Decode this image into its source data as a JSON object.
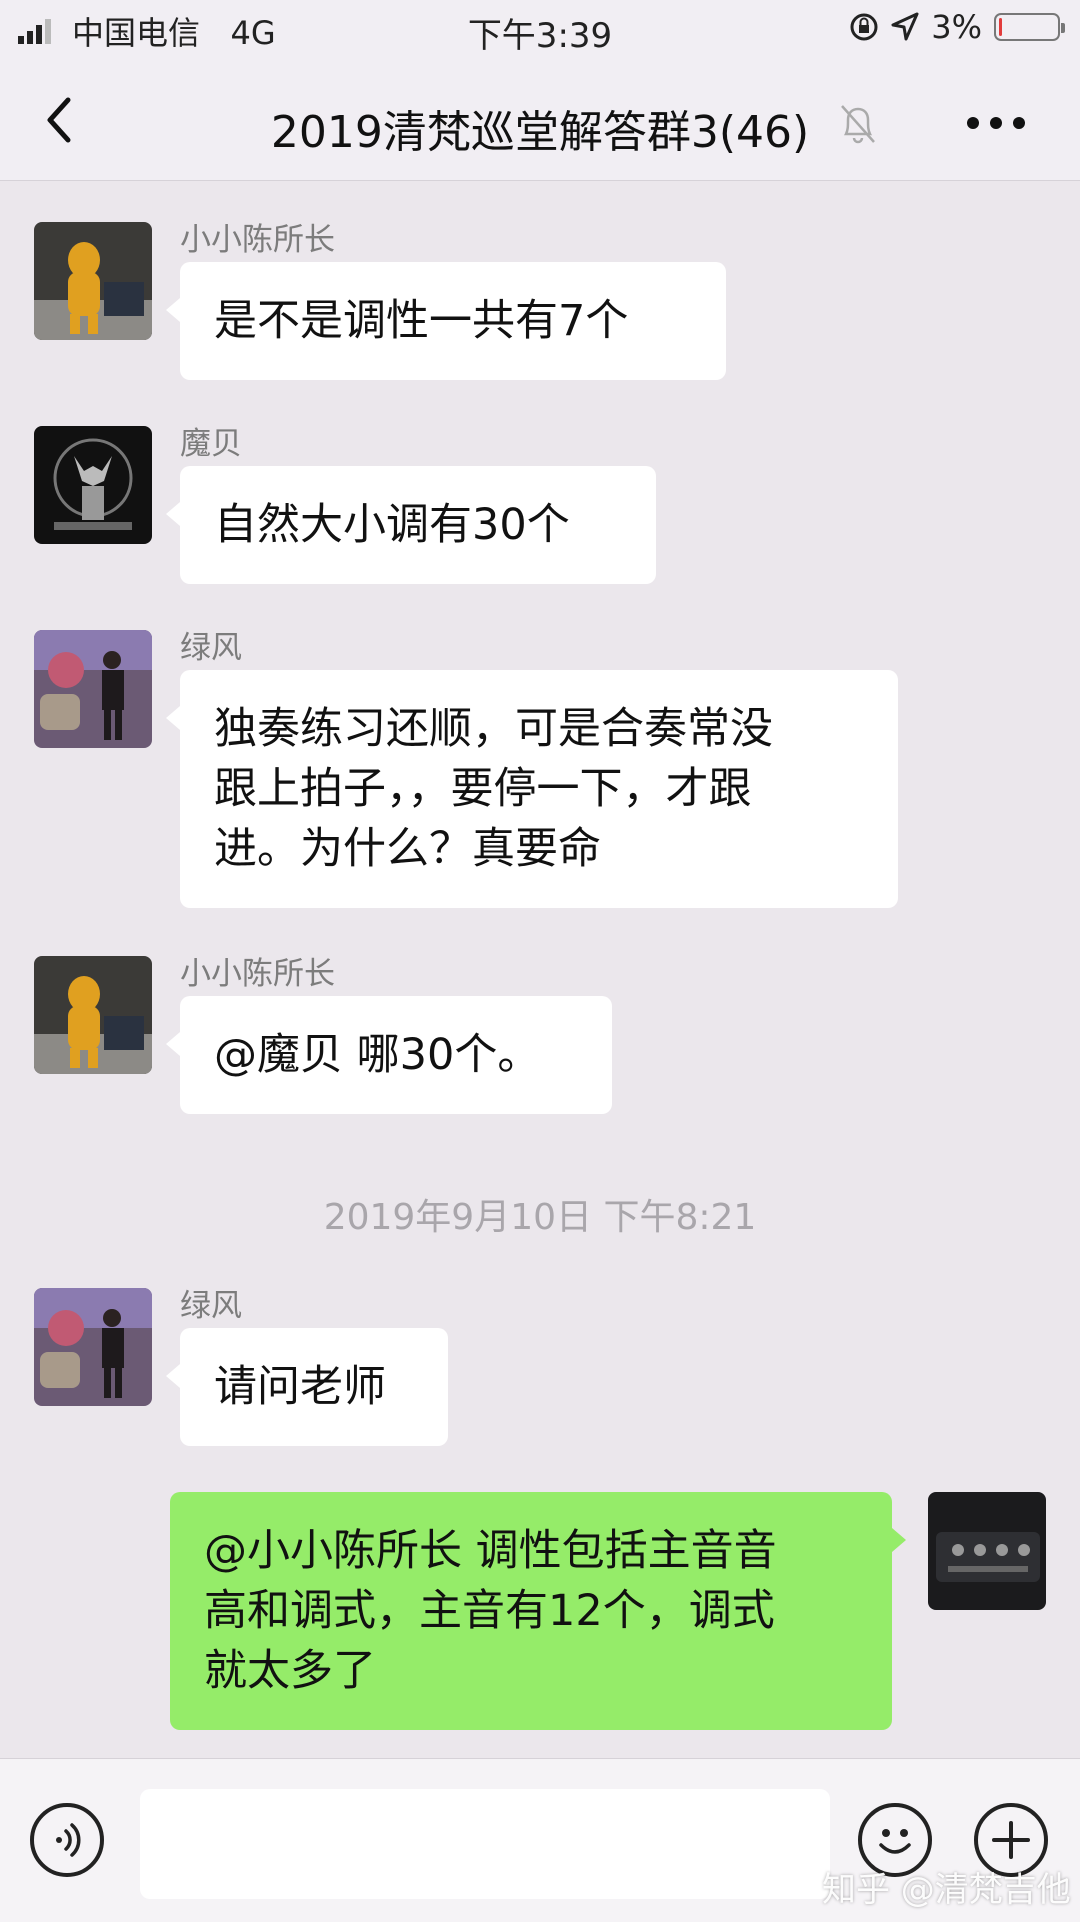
{
  "status_bar": {
    "carrier": "中国电信",
    "network": "4G",
    "time": "下午3:39",
    "battery": "3%",
    "battery_level": 0.03,
    "battery_color": "#e23b3b"
  },
  "header": {
    "title": "2019清梵巡堂解答群3(46)",
    "back_icon": "chevron-left-icon",
    "mute_icon": "bell-off-icon",
    "more_icon": "more-horizontal-icon"
  },
  "messages": [
    {
      "sender": "小小陈所长",
      "lines": [
        "是不是调性一共有7个"
      ]
    },
    {
      "sender": "魔贝",
      "lines": [
        "自然大小调有30个"
      ]
    },
    {
      "sender": "绿风",
      "lines": [
        "独奏练习还顺，可是合奏常没",
        "跟上拍子，，要停一下，才跟",
        "进。为什么？真要命"
      ]
    },
    {
      "sender": "小小陈所长",
      "lines": [
        "@魔贝 哪30个。"
      ]
    },
    {
      "timestamp": "2019年9月10日 下午8:21"
    },
    {
      "sender": "绿风",
      "lines": [
        "请问老师"
      ]
    },
    {
      "self": true,
      "lines": [
        "@小小陈所长 调性包括主音音",
        "高和调式，主音有12个，调式",
        "就太多了"
      ]
    }
  ],
  "input_bar": {
    "voice_icon": "voice-icon",
    "emoji_icon": "emoji-icon",
    "plus_icon": "plus-icon"
  },
  "watermark": "知乎 @清梵吉他",
  "colors": {
    "background": "#ebe7ec",
    "self_bubble": "#95ec69",
    "other_bubble": "#ffffff"
  }
}
